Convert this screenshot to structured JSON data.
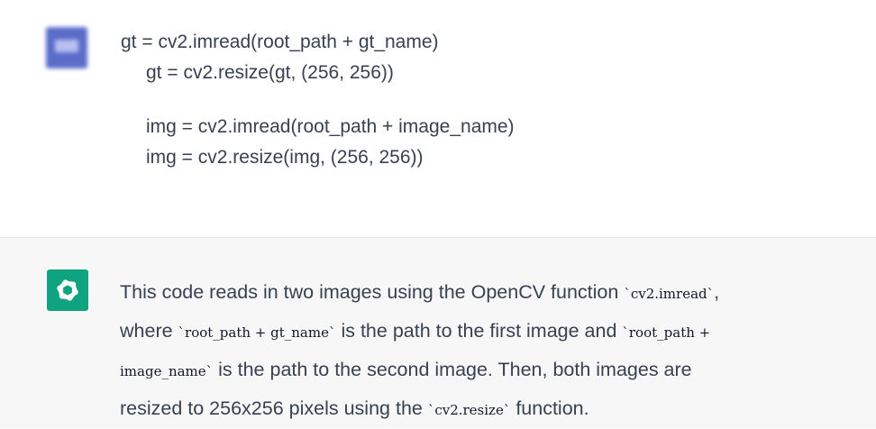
{
  "conversation": {
    "user_message": {
      "lines": [
        "gt = cv2.imread(root_path + gt_name)",
        "gt = cv2.resize(gt, (256, 256))",
        "img = cv2.imread(root_path + image_name)",
        "img = cv2.resize(img, (256, 256))"
      ]
    },
    "assistant_message": {
      "segments": [
        "This code reads in two images using the OpenCV function ",
        "`cv2.imread`",
        ",",
        "where ",
        "`root_path + gt_name`",
        " is the path to the first image and ",
        "`root_path +",
        "image_name`",
        " is the path to the second image. Then, both images are",
        "resized to 256x256 pixels using the ",
        "`cv2.resize`",
        " function."
      ]
    }
  },
  "colors": {
    "assistant_bg": "#f7f7f8",
    "assistant_avatar": "#10a37f",
    "text": "#374151"
  },
  "icons": {
    "assistant_avatar": "openai-logo-icon",
    "user_avatar": "user-avatar-blurred"
  }
}
